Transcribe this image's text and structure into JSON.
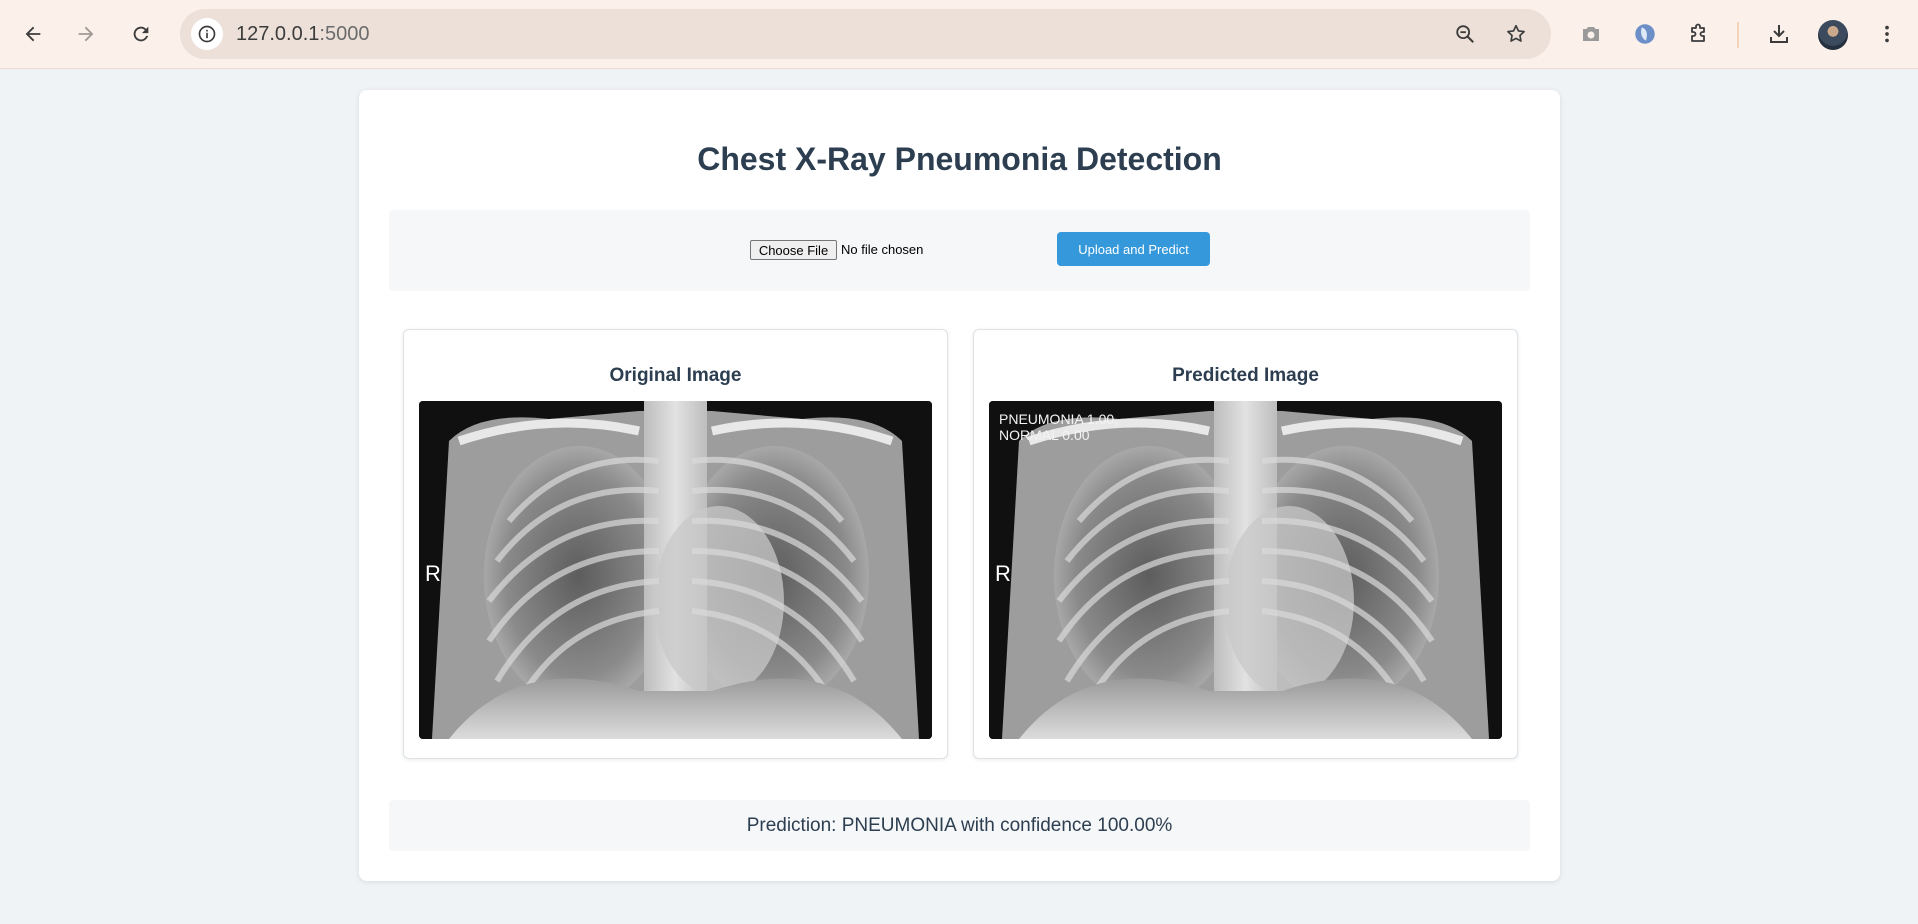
{
  "browser": {
    "url_host": "127.0.0.1",
    "url_port": ":5000"
  },
  "page": {
    "title": "Chest X-Ray Pneumonia Detection",
    "upload": {
      "choose_file_label": "Choose File",
      "file_status": "No file chosen",
      "submit_label": "Upload and Predict"
    },
    "original_panel": {
      "heading": "Original Image",
      "side_marker": "R"
    },
    "predicted_panel": {
      "heading": "Predicted Image",
      "side_marker": "R",
      "overlay_line1": "PNEUMONIA 1.00,",
      "overlay_line2": "NORMAL 0.00"
    },
    "result_text": "Prediction: PNEUMONIA with confidence 100.00%"
  },
  "colors": {
    "accent": "#3498db",
    "heading": "#2c3e50",
    "page_bg": "#f0f3f6"
  }
}
